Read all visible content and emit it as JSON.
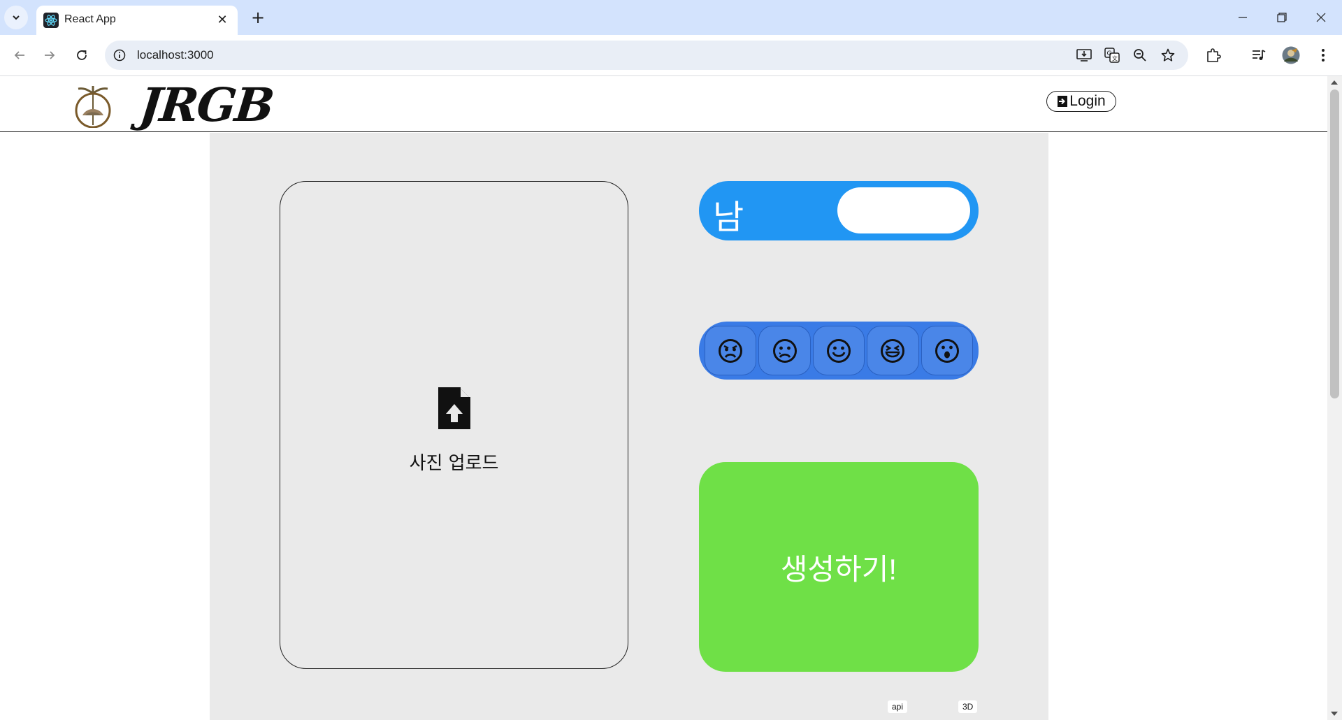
{
  "browser": {
    "tab_title": "React App",
    "url": "localhost:3000",
    "new_tab_symbol": "+",
    "close_symbol": "✕"
  },
  "header": {
    "logo_text": "JRGB",
    "login_label": "Login"
  },
  "upload": {
    "label": "사진 업로드"
  },
  "gender": {
    "label": "남"
  },
  "emotions": [
    {
      "name": "angry"
    },
    {
      "name": "sad"
    },
    {
      "name": "happy"
    },
    {
      "name": "laughing"
    },
    {
      "name": "surprised"
    }
  ],
  "generate": {
    "label": "생성하기!"
  },
  "mini_buttons": {
    "api": "api",
    "three_d": "3D"
  },
  "colors": {
    "gender_toggle": "#2196f3",
    "emotion_bar": "#3a7be6",
    "generate_button": "#6fe047",
    "content_bg": "#eaeaea"
  }
}
